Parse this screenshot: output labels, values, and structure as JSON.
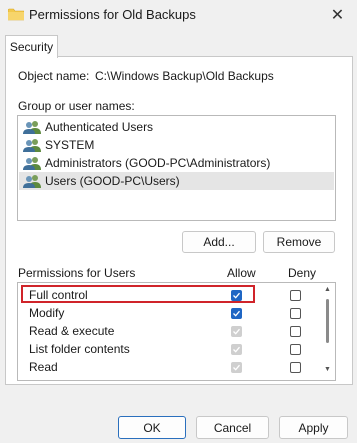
{
  "window": {
    "title": "Permissions for Old Backups",
    "close_glyph": "✕",
    "icon": "folder-icon"
  },
  "tabs": [
    {
      "label": "Security",
      "selected": true
    }
  ],
  "object": {
    "label": "Object name:",
    "value": "C:\\Windows Backup\\Old Backups"
  },
  "groups": {
    "label": "Group or user names:",
    "items": [
      {
        "name": "Authenticated Users",
        "icon": "users-icon",
        "selected": false
      },
      {
        "name": "SYSTEM",
        "icon": "users-icon",
        "selected": false
      },
      {
        "name": "Administrators (GOOD-PC\\Administrators)",
        "icon": "users-icon",
        "selected": false
      },
      {
        "name": "Users (GOOD-PC\\Users)",
        "icon": "users-icon",
        "selected": true
      }
    ]
  },
  "buttons": {
    "add": "Add...",
    "remove": "Remove",
    "ok": "OK",
    "cancel": "Cancel",
    "apply": "Apply"
  },
  "permissions": {
    "label": "Permissions for Users",
    "allow_header": "Allow",
    "deny_header": "Deny",
    "rows": [
      {
        "name": "Full control",
        "allow": "checked",
        "deny": "unchecked",
        "highlighted": true
      },
      {
        "name": "Modify",
        "allow": "checked",
        "deny": "unchecked"
      },
      {
        "name": "Read & execute",
        "allow": "disabled",
        "deny": "unchecked"
      },
      {
        "name": "List folder contents",
        "allow": "disabled",
        "deny": "unchecked"
      },
      {
        "name": "Read",
        "allow": "disabled",
        "deny": "unchecked"
      },
      {
        "name": "",
        "allow": "checked",
        "deny": "unchecked"
      }
    ]
  },
  "colors": {
    "accent": "#1f66c4",
    "highlight": "#d0242a",
    "default_border": "#2a6fbd"
  }
}
